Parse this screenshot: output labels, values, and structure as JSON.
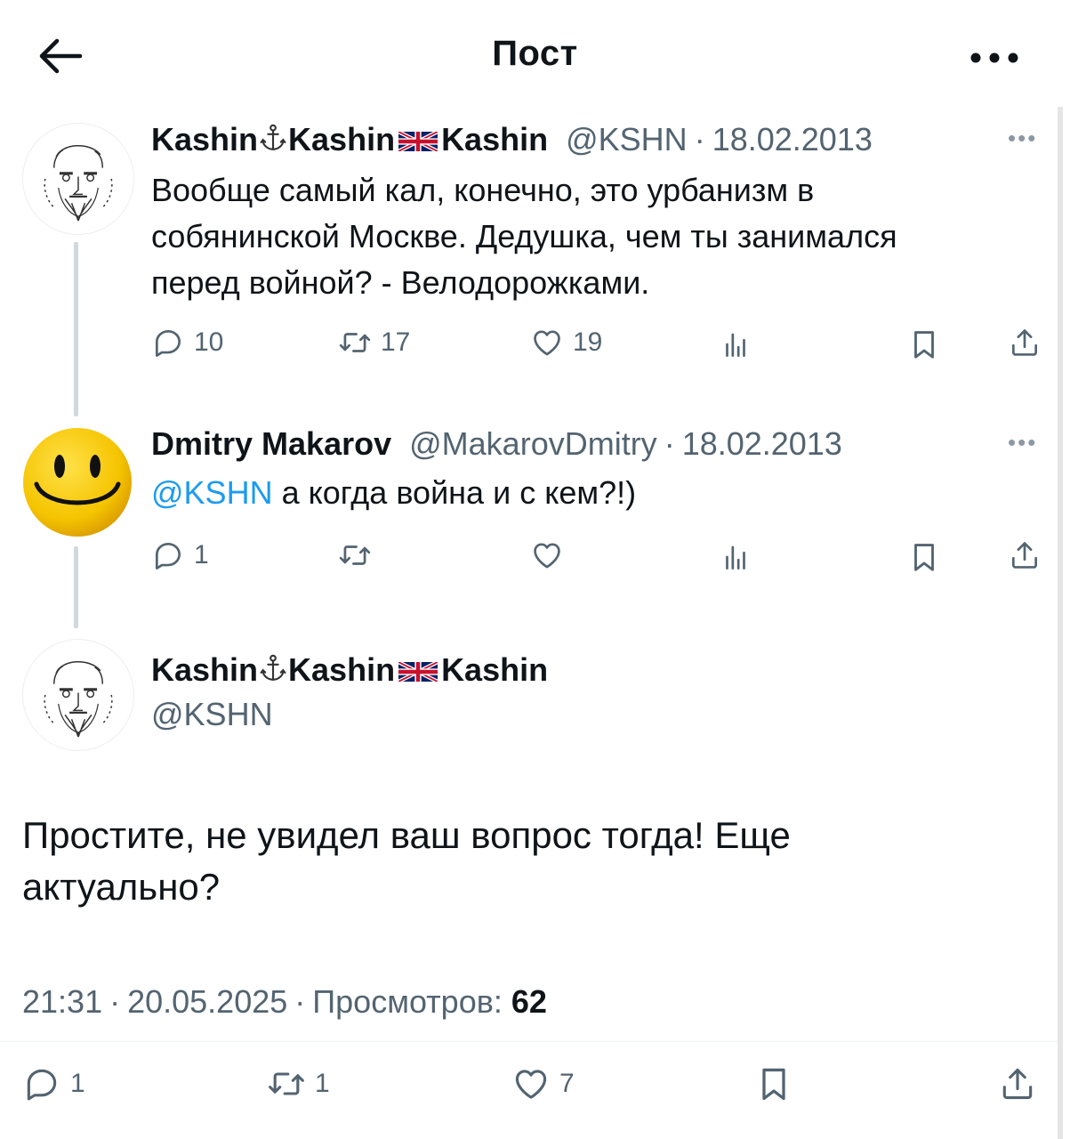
{
  "header": {
    "title": "Пост"
  },
  "tweets": [
    {
      "name_parts": [
        "Kashin",
        "Kashin",
        "Kashin"
      ],
      "handle": "@KSHN",
      "date": "18.02.2013",
      "lines": [
        "Вообще самый кал, конечно, это урбанизм в",
        "собянинской Москве. Дедушка, чем ты занимался",
        "перед войной? - Велодорожками."
      ],
      "replies": "10",
      "retweets": "17",
      "likes": "19"
    },
    {
      "name": "Dmitry Makarov",
      "handle": "@MakarovDmitry",
      "date": "18.02.2013",
      "mention": "@KSHN",
      "text": " а когда война и с кем?!)",
      "replies": "1"
    }
  ],
  "main": {
    "name_parts": [
      "Kashin",
      "Kashin",
      "Kashin"
    ],
    "handle": "@KSHN",
    "lines": [
      "Простите, не увидел ваш вопрос тогда! Еще",
      "актуально?"
    ],
    "time": "21:31",
    "date": "20.05.2025",
    "views_label": "Просмотров:",
    "views": "62",
    "replies": "1",
    "retweets": "1",
    "likes": "7"
  },
  "colors": {
    "accent": "#1d9bf0",
    "muted": "#536471",
    "text": "#0f1419"
  },
  "icons": [
    "back-arrow-icon",
    "more-icon",
    "reply-icon",
    "retweet-icon",
    "like-icon",
    "views-icon",
    "bookmark-icon",
    "share-icon",
    "anchor-icon",
    "uk-flag-icon"
  ]
}
